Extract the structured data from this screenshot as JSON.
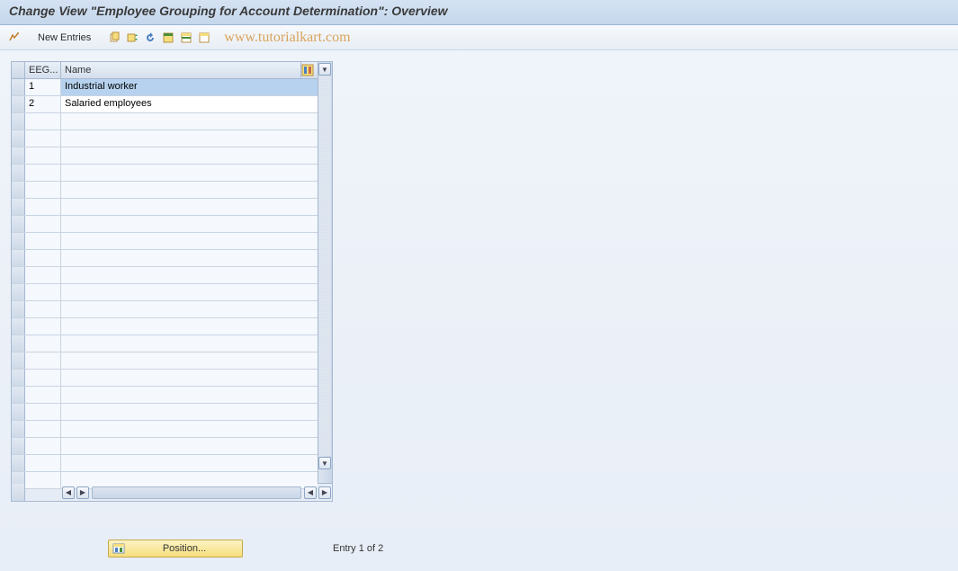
{
  "title": "Change View \"Employee Grouping for Account Determination\": Overview",
  "toolbar": {
    "new_entries": "New Entries"
  },
  "watermark": "www.tutorialkart.com",
  "table": {
    "columns": {
      "eeg": "EEG...",
      "name": "Name"
    },
    "rows": [
      {
        "eeg": "1",
        "name": "Industrial worker"
      },
      {
        "eeg": "2",
        "name": "Salaried employees"
      }
    ],
    "empty_row_count": 22
  },
  "footer": {
    "position_label": "Position...",
    "entry_text": "Entry 1 of 2"
  },
  "icons": {
    "toggle": "toggle-icon",
    "copy": "copy-icon",
    "copy_as": "copy-as-icon",
    "delete": "delete-icon",
    "select_all": "select-all-icon",
    "select_block": "select-block-icon",
    "deselect_all": "deselect-all-icon",
    "configure": "configure-icon"
  },
  "colors": {
    "header_grad_top": "#d4e2f3",
    "header_grad_bot": "#c5d7ec",
    "selected_cell": "#b6d2ef",
    "position_btn": "#f6de7c"
  }
}
